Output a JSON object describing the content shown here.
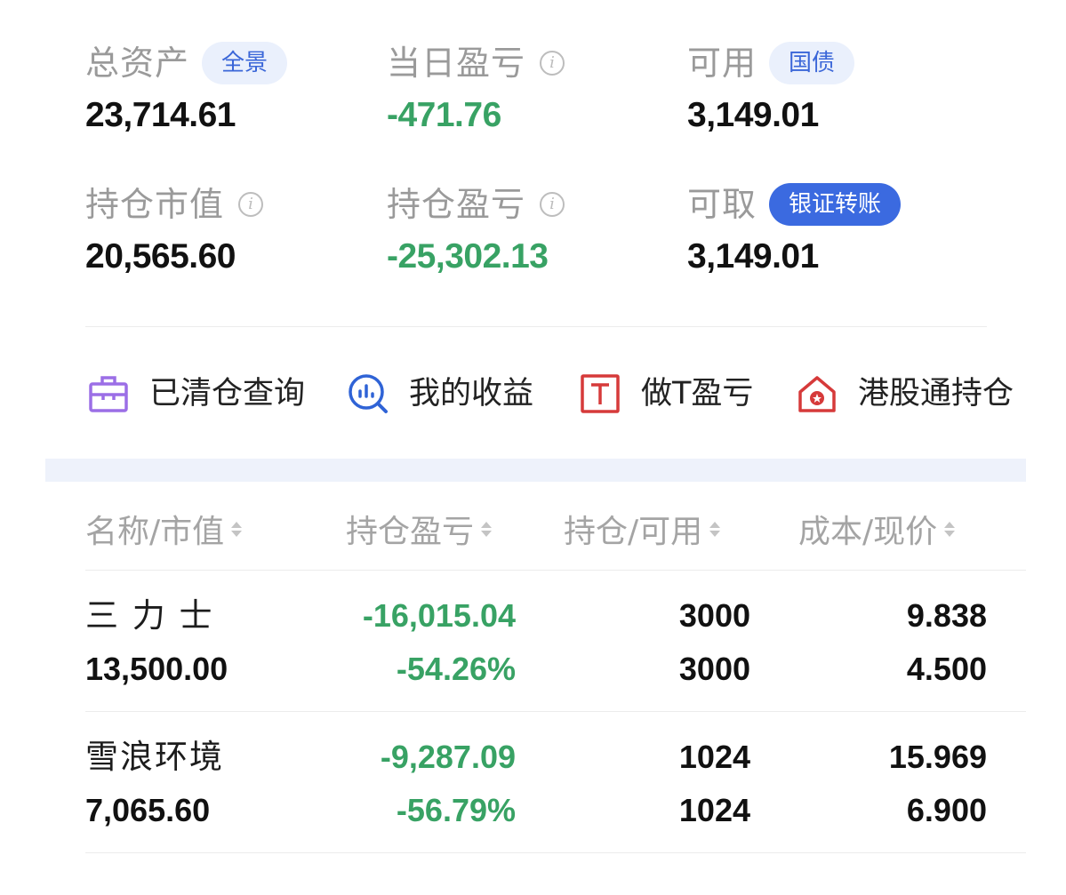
{
  "summary": {
    "total_assets": {
      "label": "总资产",
      "value": "23,714.61",
      "badge": "全景"
    },
    "daily_pnl": {
      "label": "当日盈亏",
      "value": "-471.76"
    },
    "available": {
      "label": "可用",
      "value": "3,149.01",
      "badge": "国债"
    },
    "position_value": {
      "label": "持仓市值",
      "value": "20,565.60"
    },
    "position_pnl": {
      "label": "持仓盈亏",
      "value": "-25,302.13"
    },
    "withdrawable": {
      "label": "可取",
      "value": "3,149.01",
      "badge": "银证转账"
    }
  },
  "quick_links": [
    {
      "label": "已清仓查询",
      "icon": "briefcase-icon",
      "color": "#9b6ee6"
    },
    {
      "label": "我的收益",
      "icon": "chart-search-icon",
      "color": "#2f63d6"
    },
    {
      "label": "做T盈亏",
      "icon": "t-box-icon",
      "color": "#d63a3a"
    },
    {
      "label": "港股通持仓",
      "icon": "hk-home-icon",
      "color": "#d63a3a"
    }
  ],
  "table": {
    "headers": [
      "名称/市值",
      "持仓盈亏",
      "持仓/可用",
      "成本/现价"
    ],
    "rows": [
      {
        "name": "三 力 士",
        "market_value": "13,500.00",
        "pnl": "-16,015.04",
        "pnl_pct": "-54.26%",
        "position": "3000",
        "available": "3000",
        "cost": "9.838",
        "price": "4.500"
      },
      {
        "name": "雪浪环境",
        "market_value": "7,065.60",
        "pnl": "-9,287.09",
        "pnl_pct": "-56.79%",
        "position": "1024",
        "available": "1024",
        "cost": "15.969",
        "price": "6.900"
      }
    ]
  },
  "colors": {
    "negative": "#38a264",
    "accent": "#3b6ae0",
    "muted": "#9a9a9a"
  }
}
